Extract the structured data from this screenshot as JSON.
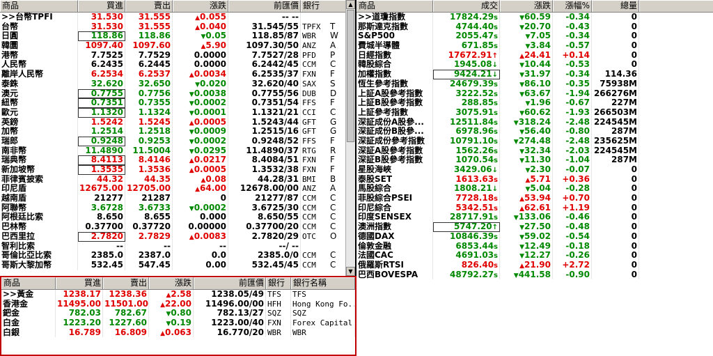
{
  "fx": {
    "headers": [
      "商品",
      "買進",
      "賣出",
      "漲跌",
      "前匯價",
      "銀行"
    ],
    "rows": [
      {
        "name": ">>台幣TPFI",
        "bid": "31.530",
        "ask": "31.555",
        "dir": "up",
        "chg": "0.055",
        "prev": "-- --",
        "bank": "",
        "c": "up"
      },
      {
        "name": "台幣",
        "bid": "31.530",
        "ask": "31.555",
        "dir": "up",
        "chg": "0.040",
        "prev": "31.545/55",
        "bank": "TPFX",
        "c": "up"
      },
      {
        "name": "日圓",
        "bid": "118.86",
        "ask": "118.86",
        "dir": "dn",
        "chg": "0.05",
        "prev": "118.85/87",
        "bank": "WBR",
        "c": "dn",
        "box": true
      },
      {
        "name": "韓圜",
        "bid": "1097.40",
        "ask": "1097.60",
        "dir": "up",
        "chg": "5.90",
        "prev": "1097.30/50",
        "bank": "ANZ",
        "c": "up"
      },
      {
        "name": "港幣",
        "bid": "7.7525",
        "ask": "7.7529",
        "dir": "",
        "chg": "0.0000",
        "prev": "7.7527/28",
        "bank": "PFD",
        "c": "bk"
      },
      {
        "name": "人民幣",
        "bid": "6.2435",
        "ask": "6.2445",
        "dir": "",
        "chg": "0.0000",
        "prev": "6.2442/45",
        "bank": "CCM",
        "c": "bk"
      },
      {
        "name": "離岸人民幣",
        "bid": "6.2534",
        "ask": "6.2537",
        "dir": "up",
        "chg": "0.0034",
        "prev": "6.2535/37",
        "bank": "FXN",
        "c": "up"
      },
      {
        "name": "泰銖",
        "bid": "32.620",
        "ask": "32.650",
        "dir": "dn",
        "chg": "0.020",
        "prev": "32.620/40",
        "bank": "SAX",
        "c": "dn"
      },
      {
        "name": "澳元",
        "bid": "0.7755",
        "ask": "0.7756",
        "dir": "dn",
        "chg": "0.0038",
        "prev": "0.7755/56",
        "bank": "DUB",
        "c": "dn",
        "box": true
      },
      {
        "name": "紐幣",
        "bid": "0.7351",
        "ask": "0.7355",
        "dir": "dn",
        "chg": "0.0002",
        "prev": "0.7351/54",
        "bank": "FFS",
        "c": "dn",
        "box": true
      },
      {
        "name": "歐元",
        "bid": "1.1320",
        "ask": "1.1324",
        "dir": "dn",
        "chg": "0.0001",
        "prev": "1.1321/21",
        "bank": "CCI",
        "c": "dn",
        "box": true
      },
      {
        "name": "英鎊",
        "bid": "1.5242",
        "ask": "1.5245",
        "dir": "up",
        "chg": "0.0005",
        "prev": "1.5243/44",
        "bank": "GFT",
        "c": "up"
      },
      {
        "name": "加幣",
        "bid": "1.2514",
        "ask": "1.2518",
        "dir": "dn",
        "chg": "0.0009",
        "prev": "1.2515/16",
        "bank": "GFT",
        "c": "dn"
      },
      {
        "name": "瑞郎",
        "bid": "0.9248",
        "ask": "0.9253",
        "dir": "dn",
        "chg": "0.0002",
        "prev": "0.9248/52",
        "bank": "FFS",
        "c": "dn",
        "box": true
      },
      {
        "name": "南非幣",
        "bid": "11.4890",
        "ask": "11.5004",
        "dir": "dn",
        "chg": "0.0295",
        "prev": "11.4890/37",
        "bank": "RTG",
        "c": "dn"
      },
      {
        "name": "瑞典幣",
        "bid": "8.4113",
        "ask": "8.4146",
        "dir": "up",
        "chg": "0.0217",
        "prev": "8.4084/51",
        "bank": "FXN",
        "c": "up",
        "box": true
      },
      {
        "name": "新加坡幣",
        "bid": "1.3535",
        "ask": "1.3536",
        "dir": "up",
        "chg": "0.0005",
        "prev": "1.3532/38",
        "bank": "FXN",
        "c": "up",
        "box": true
      },
      {
        "name": "菲律賓披索",
        "bid": "44.32",
        "ask": "44.35",
        "dir": "up",
        "chg": "0.08",
        "prev": "44.28/31",
        "bank": "BMI",
        "c": "up"
      },
      {
        "name": "印尼盾",
        "bid": "12675.00",
        "ask": "12705.00",
        "dir": "up",
        "chg": "64.00",
        "prev": "12678.00/00",
        "bank": "ANZ",
        "c": "up"
      },
      {
        "name": "越南盾",
        "bid": "21277",
        "ask": "21287",
        "dir": "",
        "chg": "0",
        "prev": "21277/87",
        "bank": "CCM",
        "c": "bk"
      },
      {
        "name": "阿聯幣",
        "bid": "3.6728",
        "ask": "3.6733",
        "dir": "dn",
        "chg": "0.0002",
        "prev": "3.6725/30",
        "bank": "CCM",
        "c": "dn"
      },
      {
        "name": "阿根廷比索",
        "bid": "8.650",
        "ask": "8.655",
        "dir": "",
        "chg": "0.000",
        "prev": "8.650/55",
        "bank": "CCM",
        "c": "bk"
      },
      {
        "name": "巴林幣",
        "bid": "0.37700",
        "ask": "0.37720",
        "dir": "",
        "chg": "0.00000",
        "prev": "0.37700/20",
        "bank": "CCM",
        "c": "bk"
      },
      {
        "name": "巴西里拉",
        "bid": "2.7820",
        "ask": "2.7829",
        "dir": "up",
        "chg": "0.0083",
        "prev": "2.7820/29",
        "bank": "OTC",
        "c": "up",
        "box": true
      },
      {
        "name": "智利比索",
        "bid": "--",
        "ask": "--",
        "dir": "",
        "chg": "--",
        "prev": "--/ --",
        "bank": "",
        "c": "bk"
      },
      {
        "name": "哥倫比亞比索",
        "bid": "2385.0",
        "ask": "2387.0",
        "dir": "",
        "chg": "0.0",
        "prev": "2385.0/0",
        "bank": "CCM",
        "c": "bk"
      },
      {
        "name": "哥斯大黎加幣",
        "bid": "532.45",
        "ask": "547.45",
        "dir": "",
        "chg": "0.00",
        "prev": "532.45/45",
        "bank": "CCM",
        "c": "bk"
      }
    ],
    "bank_extra": [
      "",
      "T",
      "W",
      "A",
      "P",
      "C",
      "F",
      "S",
      "D",
      "F",
      "C",
      "G",
      "G",
      "F",
      "R",
      "F",
      "F",
      "B",
      "A",
      "C",
      "C",
      "C",
      "C",
      "O",
      "",
      "C",
      "C"
    ]
  },
  "metals": {
    "headers": [
      "商品",
      "買進",
      "賣出",
      "漲跌",
      "前匯價",
      "銀行",
      "銀行名稱"
    ],
    "rows": [
      {
        "name": ">>黃金",
        "bid": "1238.17",
        "ask": "1238.36",
        "dir": "up",
        "chg": "2.58",
        "prev": "1238.05/49",
        "bank": "TFS",
        "bankname": "TFS",
        "c": "up"
      },
      {
        "name": "香港金",
        "bid": "11495.00",
        "ask": "11501.00",
        "dir": "up",
        "chg": "22.00",
        "prev": "11496.00/00",
        "bank": "HFH",
        "bankname": "Hong Kong Fo...",
        "c": "up"
      },
      {
        "name": "鈀金",
        "bid": "782.03",
        "ask": "782.67",
        "dir": "dn",
        "chg": "0.80",
        "prev": "782.13/27",
        "bank": "SQZ",
        "bankname": "SQZ",
        "c": "dn"
      },
      {
        "name": "白金",
        "bid": "1223.20",
        "ask": "1227.60",
        "dir": "dn",
        "chg": "0.19",
        "prev": "1223.00/40",
        "bank": "FXN",
        "bankname": "Forex Capital ...",
        "c": "dn"
      },
      {
        "name": "白銀",
        "bid": "16.789",
        "ask": "16.809",
        "dir": "up",
        "chg": "0.063",
        "prev": "16.770/20",
        "bank": "WBR",
        "bankname": "WBR",
        "c": "up"
      }
    ]
  },
  "idx": {
    "headers": [
      "商品",
      "成交",
      "漲跌",
      "漲幅%",
      "總量"
    ],
    "rows": [
      {
        "name": ">>道瓊指數",
        "last": "17824.29",
        "tick": "s",
        "dir": "dn",
        "chg": "60.59",
        "pct": "-0.34",
        "vol": "0",
        "c": "dn"
      },
      {
        "name": "那斯達克指數",
        "last": "4744.40",
        "tick": "s",
        "dir": "dn",
        "chg": "20.70",
        "pct": "-0.43",
        "vol": "0",
        "c": "dn"
      },
      {
        "name": "S&P500",
        "last": "2055.47",
        "tick": "s",
        "dir": "dn",
        "chg": "7.05",
        "pct": "-0.34",
        "vol": "0",
        "c": "dn"
      },
      {
        "name": "費城半導體",
        "last": "671.85",
        "tick": "s",
        "dir": "dn",
        "chg": "3.84",
        "pct": "-0.57",
        "vol": "0",
        "c": "dn"
      },
      {
        "name": "日經指數",
        "last": "17672.91",
        "tick": "↑",
        "dir": "up",
        "chg": "24.41",
        "pct": "+0.14",
        "vol": "0",
        "c": "up"
      },
      {
        "name": "韓股綜合",
        "last": "1945.08",
        "tick": "↓",
        "dir": "dn",
        "chg": "10.44",
        "pct": "-0.53",
        "vol": "0",
        "c": "dn"
      },
      {
        "name": "加權指數",
        "last": "9424.21",
        "tick": "↓",
        "dir": "dn",
        "chg": "31.97",
        "pct": "-0.34",
        "vol": "114.36",
        "c": "dn",
        "box": true
      },
      {
        "name": "恆生參考指數",
        "last": "24679.39",
        "tick": "s",
        "dir": "dn",
        "chg": "86.10",
        "pct": "-0.35",
        "vol": "75938M",
        "c": "dn"
      },
      {
        "name": "上証A股參考指數",
        "last": "3222.52",
        "tick": "s",
        "dir": "dn",
        "chg": "63.67",
        "pct": "-1.94",
        "vol": "266276M",
        "c": "dn"
      },
      {
        "name": "上証B股參考指數",
        "last": "288.85",
        "tick": "s",
        "dir": "dn",
        "chg": "1.96",
        "pct": "-0.67",
        "vol": "227M",
        "c": "dn"
      },
      {
        "name": "上証參考指數",
        "last": "3075.91",
        "tick": "s",
        "dir": "dn",
        "chg": "60.62",
        "pct": "-1.93",
        "vol": "266503M",
        "c": "dn"
      },
      {
        "name": "深証成份A股參...",
        "last": "12511.84",
        "tick": "s",
        "dir": "dn",
        "chg": "318.24",
        "pct": "-2.48",
        "vol": "224545M",
        "c": "dn"
      },
      {
        "name": "深証成份B股參...",
        "last": "6978.96",
        "tick": "s",
        "dir": "dn",
        "chg": "56.40",
        "pct": "-0.80",
        "vol": "287M",
        "c": "dn"
      },
      {
        "name": "深証成份參考指數",
        "last": "10791.10",
        "tick": "s",
        "dir": "dn",
        "chg": "274.48",
        "pct": "-2.48",
        "vol": "235625M",
        "c": "dn"
      },
      {
        "name": "深証A股參考指數",
        "last": "1562.26",
        "tick": "s",
        "dir": "dn",
        "chg": "32.34",
        "pct": "-2.03",
        "vol": "224545M",
        "c": "dn"
      },
      {
        "name": "深証B股參考指數",
        "last": "1070.54",
        "tick": "s",
        "dir": "dn",
        "chg": "11.30",
        "pct": "-1.04",
        "vol": "287M",
        "c": "dn"
      },
      {
        "name": "星股海峽",
        "last": "3429.06",
        "tick": "↓",
        "dir": "dn",
        "chg": "2.30",
        "pct": "-0.07",
        "vol": "0",
        "c": "dn"
      },
      {
        "name": "泰股SET",
        "last": "1613.63",
        "tick": "s",
        "dir": "up",
        "chg": "5.71",
        "pct": "+0.36",
        "vol": "0",
        "c": "up"
      },
      {
        "name": "馬股綜合",
        "last": "1808.21",
        "tick": "↓",
        "dir": "dn",
        "chg": "5.04",
        "pct": "-0.28",
        "vol": "0",
        "c": "dn"
      },
      {
        "name": "菲股綜合PSEI",
        "last": "7728.18",
        "tick": "s",
        "dir": "up",
        "chg": "53.94",
        "pct": "+0.70",
        "vol": "0",
        "c": "up"
      },
      {
        "name": "印尼綜合",
        "last": "5342.51",
        "tick": "s",
        "dir": "up",
        "chg": "62.61",
        "pct": "+1.19",
        "vol": "0",
        "c": "up"
      },
      {
        "name": "印度SENSEX",
        "last": "28717.91",
        "tick": "s",
        "dir": "dn",
        "chg": "133.06",
        "pct": "-0.46",
        "vol": "0",
        "c": "dn"
      },
      {
        "name": "澳洲指數",
        "last": "5747.20",
        "tick": "↑",
        "dir": "dn",
        "chg": "27.50",
        "pct": "-0.48",
        "vol": "0",
        "c": "dn",
        "box": true
      },
      {
        "name": "德國DAX",
        "last": "10846.39",
        "tick": "s",
        "dir": "dn",
        "chg": "59.02",
        "pct": "-0.54",
        "vol": "0",
        "c": "dn"
      },
      {
        "name": "倫敦金融",
        "last": "6853.44",
        "tick": "s",
        "dir": "dn",
        "chg": "12.49",
        "pct": "-0.18",
        "vol": "0",
        "c": "dn"
      },
      {
        "name": "法國CAC",
        "last": "4691.03",
        "tick": "s",
        "dir": "dn",
        "chg": "12.27",
        "pct": "-0.26",
        "vol": "0",
        "c": "dn"
      },
      {
        "name": "俄羅斯RTSI",
        "last": "826.40",
        "tick": "s",
        "dir": "up",
        "chg": "21.90",
        "pct": "+2.72",
        "vol": "0",
        "c": "up"
      },
      {
        "name": "巴西BOVESPA",
        "last": "48792.27",
        "tick": "s",
        "dir": "dn",
        "chg": "441.58",
        "pct": "-0.90",
        "vol": "0",
        "c": "dn"
      }
    ]
  },
  "icons": {
    "up": "▲",
    "down": "▼",
    "scroll_up": "▲",
    "scroll_down": "▼"
  },
  "colors": {
    "up": "#e00000",
    "down": "#008800",
    "flat": "#000000",
    "frame": "#c00000"
  }
}
